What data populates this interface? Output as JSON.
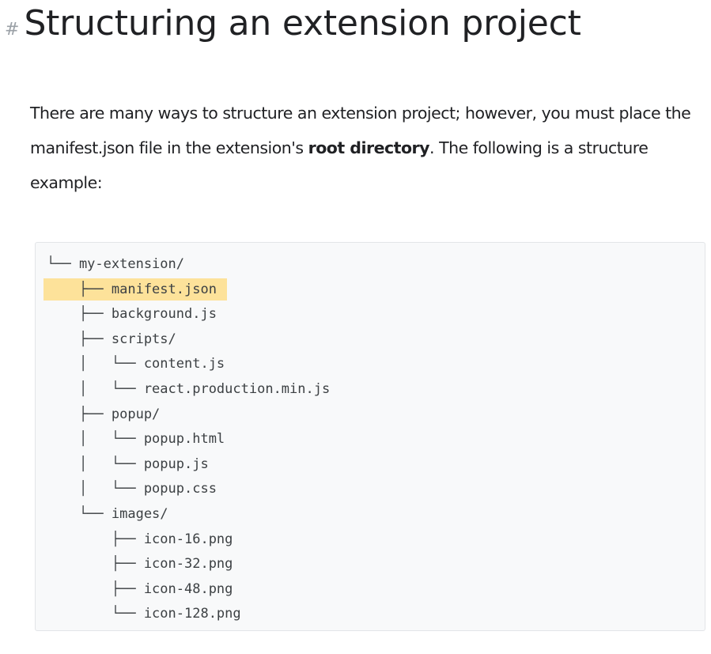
{
  "heading": {
    "anchor": "#",
    "title": "Structuring an extension project"
  },
  "intro": {
    "part1": "There are many ways to structure an extension project; however, you must place the manifest.json file in the extension's ",
    "bold": "root directory",
    "part2": ". The following is a structure example:"
  },
  "code": {
    "highlighted_index": 1,
    "lines": [
      "└── my-extension/",
      "    ├── manifest.json",
      "    ├── background.js",
      "    ├── scripts/",
      "    │   └── content.js",
      "    │   └── react.production.min.js",
      "    ├── popup/",
      "    │   └── popup.html",
      "    │   └── popup.js",
      "    │   └── popup.css",
      "    └── images/",
      "        ├── icon-16.png",
      "        ├── icon-32.png",
      "        ├── icon-48.png",
      "        └── icon-128.png"
    ]
  },
  "colors": {
    "highlight": "#fde29a",
    "code_background": "#f8f9fa",
    "text": "#202124",
    "anchor": "#9aa0a6"
  }
}
